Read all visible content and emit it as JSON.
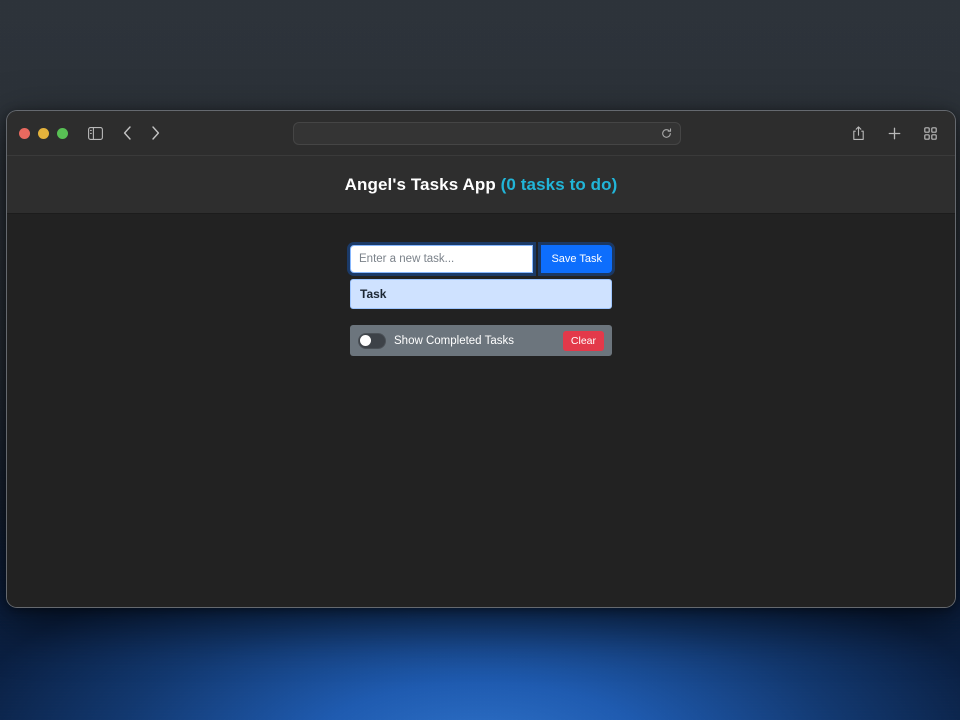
{
  "desktop": {
    "wallpaper_top_color": "#2d333a",
    "wallpaper_glow_color": "#2f72c9"
  },
  "browser": {
    "traffic_lights": [
      {
        "name": "close",
        "color": "#e8695f"
      },
      {
        "name": "minimize",
        "color": "#e4b23c"
      },
      {
        "name": "maximize",
        "color": "#58c054"
      }
    ],
    "sidebar_toggle_icon": "sidebar-icon",
    "back_icon": "chevron-left-icon",
    "forward_icon": "chevron-right-icon",
    "address_bar": {
      "value": "",
      "placeholder": "",
      "reload_icon": "reload-icon"
    },
    "right_icons": [
      {
        "name": "share-icon"
      },
      {
        "name": "new-tab-icon"
      },
      {
        "name": "tab-overview-icon"
      }
    ]
  },
  "app": {
    "title": "Angel's Tasks App",
    "task_count_text": "(0 tasks to do)",
    "accent_color": "#21b5d8",
    "input": {
      "value": "",
      "placeholder": "Enter a new task..."
    },
    "save_label": "Save Task",
    "list_header": "Task",
    "list_items": [],
    "footer": {
      "toggle_label": "Show Completed Tasks",
      "toggle_state": "off",
      "clear_label": "Clear",
      "clear_color": "#e3394a"
    }
  }
}
